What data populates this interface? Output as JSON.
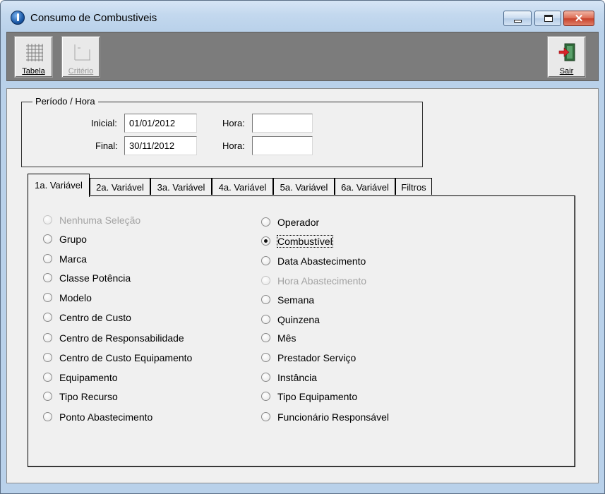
{
  "window": {
    "title": "Consumo de Combustiveis",
    "controls": {
      "minimize": "minimize",
      "maximize": "maximize",
      "close": "✕"
    }
  },
  "toolbar": {
    "tabela_label": "Tabela",
    "criterio_label": "Critério",
    "sair_label": "Sair"
  },
  "periodo": {
    "legend": "Período / Hora",
    "inicial_label": "Inicial:",
    "inicial_value": "01/01/2012",
    "final_label": "Final:",
    "final_value": "30/11/2012",
    "hora_label": "Hora:",
    "hora_inicial_value": "",
    "hora_final_value": ""
  },
  "tabs": [
    {
      "label": "1a. Variável",
      "active": true
    },
    {
      "label": "2a. Variável",
      "active": false
    },
    {
      "label": "3a. Variável",
      "active": false
    },
    {
      "label": "4a. Variável",
      "active": false
    },
    {
      "label": "5a. Variável",
      "active": false
    },
    {
      "label": "6a. Variável",
      "active": false
    },
    {
      "label": "Filtros",
      "active": false
    }
  ],
  "options_left": [
    {
      "label": "Nenhuma Seleção",
      "state": "disabled"
    },
    {
      "label": "Grupo",
      "state": "normal"
    },
    {
      "label": "Marca",
      "state": "normal"
    },
    {
      "label": "Classe Potência",
      "state": "normal"
    },
    {
      "label": "Modelo",
      "state": "normal"
    },
    {
      "label": "Centro de Custo",
      "state": "normal"
    },
    {
      "label": "Centro de Responsabilidade",
      "state": "normal"
    },
    {
      "label": "Centro de Custo Equipamento",
      "state": "normal"
    },
    {
      "label": "Equipamento",
      "state": "normal"
    },
    {
      "label": "Tipo Recurso",
      "state": "normal"
    },
    {
      "label": "Ponto Abastecimento",
      "state": "normal"
    }
  ],
  "options_right": [
    {
      "label": "Operador",
      "state": "normal"
    },
    {
      "label": "Combustível",
      "state": "checked"
    },
    {
      "label": "Data Abastecimento",
      "state": "normal"
    },
    {
      "label": "Hora Abastecimento",
      "state": "disabled"
    },
    {
      "label": "Semana",
      "state": "normal"
    },
    {
      "label": "Quinzena",
      "state": "normal"
    },
    {
      "label": "Mês",
      "state": "normal"
    },
    {
      "label": "Prestador Serviço",
      "state": "normal"
    },
    {
      "label": "Instância",
      "state": "normal"
    },
    {
      "label": "Tipo Equipamento",
      "state": "normal"
    },
    {
      "label": "Funcionário Responsável",
      "state": "normal"
    }
  ],
  "icons": {
    "app": "app-icon",
    "tabela": "grid-icon",
    "criterio": "criteria-icon",
    "sair": "exit-door-icon"
  }
}
